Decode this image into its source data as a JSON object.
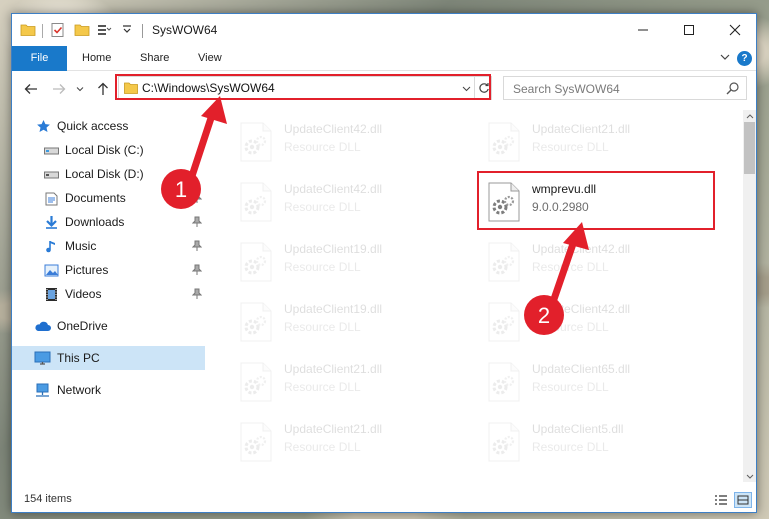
{
  "window": {
    "title": "SysWOW64",
    "ribbon_tabs": [
      "File",
      "Home",
      "Share",
      "View"
    ]
  },
  "navigation": {
    "address": "C:\\Windows\\SysWOW64",
    "search_placeholder": "Search SysWOW64"
  },
  "sidebar": {
    "items": [
      {
        "label": "Quick access",
        "icon": "star-icon",
        "pinned": false
      },
      {
        "label": "Local Disk (C:)",
        "icon": "drive-icon",
        "pinned": false
      },
      {
        "label": "Local Disk (D:)",
        "icon": "drive-icon",
        "pinned": false
      },
      {
        "label": "Documents",
        "icon": "documents-icon",
        "pinned": true
      },
      {
        "label": "Downloads",
        "icon": "download-icon",
        "pinned": true
      },
      {
        "label": "Music",
        "icon": "music-icon",
        "pinned": true
      },
      {
        "label": "Pictures",
        "icon": "pictures-icon",
        "pinned": true
      },
      {
        "label": "Videos",
        "icon": "videos-icon",
        "pinned": true
      },
      {
        "label": "OneDrive",
        "icon": "cloud-icon",
        "pinned": false
      },
      {
        "label": "This PC",
        "icon": "computer-icon",
        "pinned": false,
        "selected": true
      },
      {
        "label": "Network",
        "icon": "network-icon",
        "pinned": false
      }
    ]
  },
  "files": {
    "left_column": [
      {
        "name": "UpdateClient42.dll",
        "desc": "Resource DLL"
      },
      {
        "name": "UpdateClient42.dll",
        "desc": "Resource DLL"
      },
      {
        "name": "UpdateClient19.dll",
        "desc": "Resource DLL"
      },
      {
        "name": "UpdateClient19.dll",
        "desc": "Resource DLL"
      },
      {
        "name": "UpdateClient21.dll",
        "desc": "Resource DLL"
      },
      {
        "name": "UpdateClient21.dll",
        "desc": "Resource DLL"
      }
    ],
    "right_column": [
      {
        "name": "UpdateClient21.dll",
        "desc": "Resource DLL"
      },
      {
        "name": "wmprevu.dll",
        "desc": "9.0.0.2980",
        "highlighted": true
      },
      {
        "name": "UpdateClient42.dll",
        "desc": "Resource DLL"
      },
      {
        "name": "UpdateClient42.dll",
        "desc": "Resource DLL"
      },
      {
        "name": "UpdateClient65.dll",
        "desc": "Resource DLL"
      },
      {
        "name": "UpdateClient5.dll",
        "desc": "Resource DLL"
      }
    ]
  },
  "status": {
    "item_count": "154 items"
  },
  "annotations": {
    "step1": "1",
    "step2": "2",
    "color": "#e2202b"
  }
}
